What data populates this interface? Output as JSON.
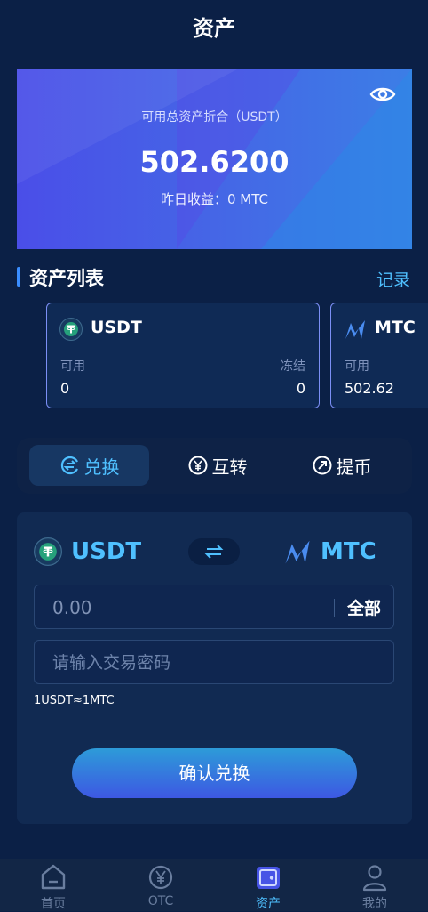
{
  "header": {
    "title": "资产"
  },
  "summary": {
    "label": "可用总资产折合（USDT）",
    "total": "502.6200",
    "yesterday": "昨日收益：0 MTC"
  },
  "assets_section": {
    "title": "资产列表",
    "records_link": "记录",
    "cards": [
      {
        "coin": "USDT",
        "available_label": "可用",
        "available": "0",
        "frozen_label": "冻结",
        "frozen": "0"
      },
      {
        "coin": "MTC",
        "available_label": "可用",
        "available": "502.62"
      }
    ]
  },
  "tabs": [
    {
      "label": "兑换",
      "active": true
    },
    {
      "label": "互转",
      "active": false
    },
    {
      "label": "提币",
      "active": false
    }
  ],
  "exchange": {
    "from_coin": "USDT",
    "to_coin": "MTC",
    "amount_placeholder": "0.00",
    "all_label": "全部",
    "password_placeholder": "请输入交易密码",
    "rate": "1USDT≈1MTC",
    "confirm_label": "确认兑换"
  },
  "bottom_nav": [
    {
      "label": "首页",
      "icon": "home-icon",
      "active": false
    },
    {
      "label": "OTC",
      "icon": "yen-coin-icon",
      "active": false
    },
    {
      "label": "资产",
      "icon": "wallet-icon",
      "active": true
    },
    {
      "label": "我的",
      "icon": "user-icon",
      "active": false
    }
  ],
  "colors": {
    "background": "#0b2046",
    "accent": "#4fc0ff",
    "card_border": "#7c8ff5",
    "tether_green": "#26a17b"
  }
}
